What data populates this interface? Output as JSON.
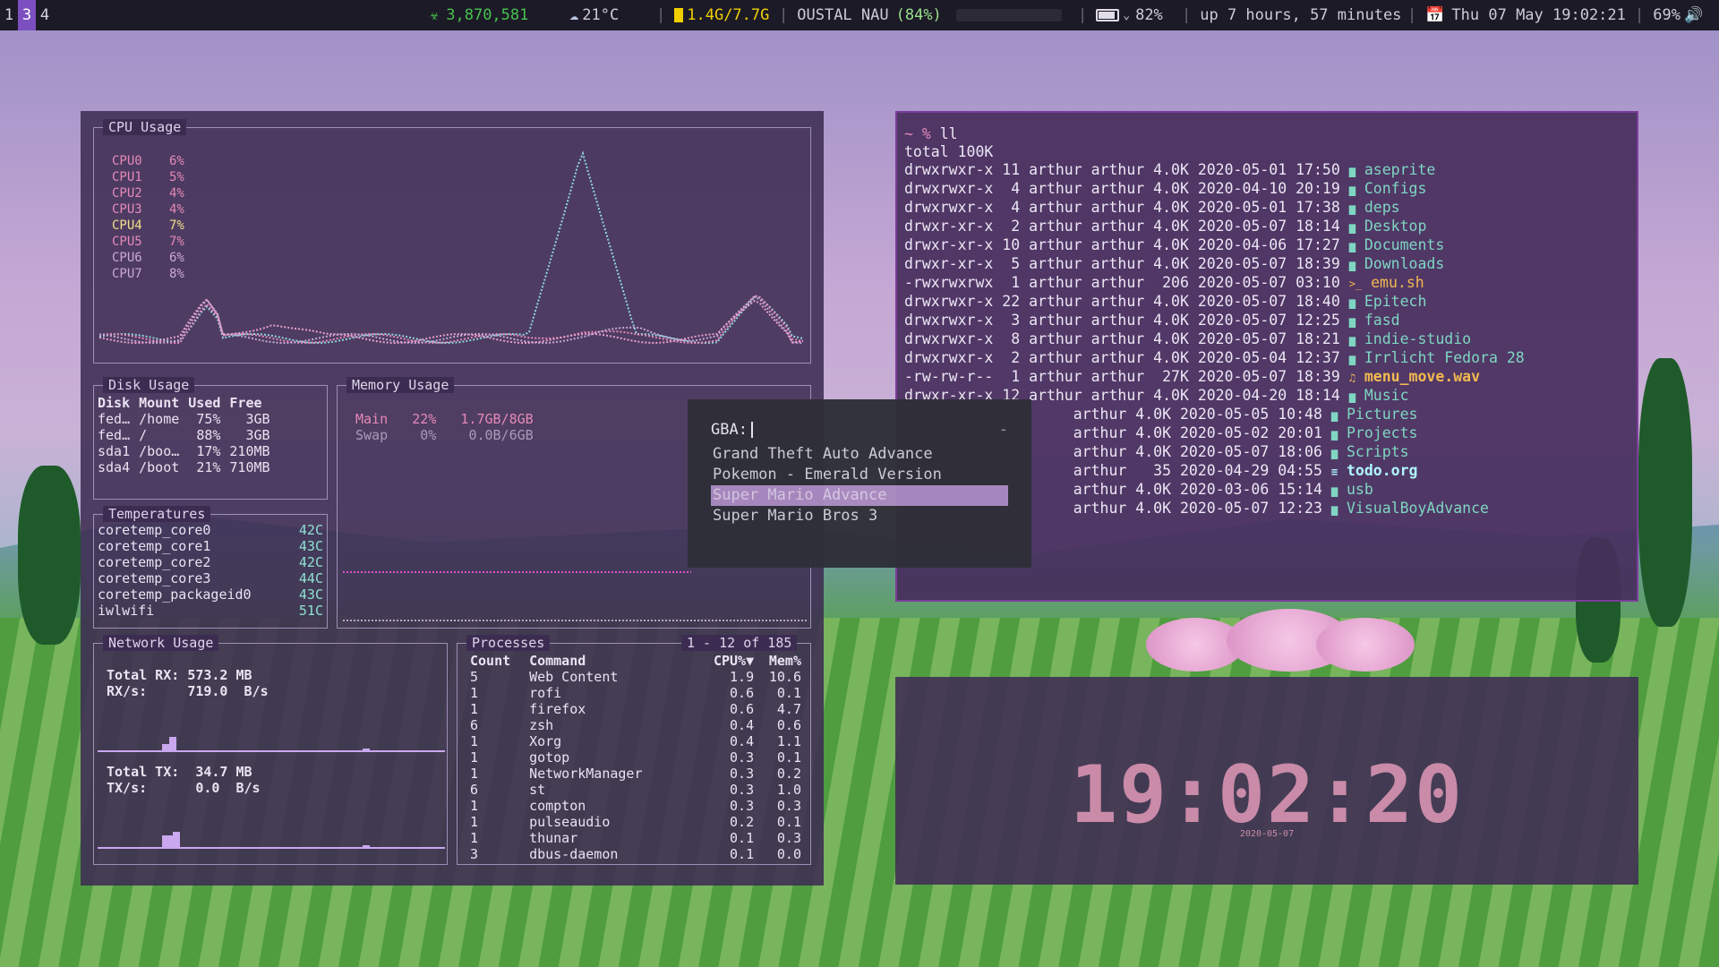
{
  "topbar": {
    "workspaces": [
      {
        "label": "1",
        "active": false
      },
      {
        "label": "3",
        "active": true
      },
      {
        "label": "4",
        "active": false
      }
    ],
    "counter": "3,870,581",
    "weather": "21°C",
    "memory": "1.4G/7.7G",
    "network_name": "OUSTAL NAU",
    "network_strength": "(84%)",
    "battery": "82%",
    "uptime": "up 7 hours, 57 minutes",
    "datetime": "Thu 07 May 19:02:21",
    "volume": "69%",
    "colors": {
      "counter": "#46c24e",
      "memory": "#f0d000",
      "network_strength": "#9ae08c"
    }
  },
  "system_monitor": {
    "cpu": {
      "title": "CPU Usage",
      "cores": [
        {
          "name": "CPU0",
          "value": "6%"
        },
        {
          "name": "CPU1",
          "value": "5%"
        },
        {
          "name": "CPU2",
          "value": "4%"
        },
        {
          "name": "CPU3",
          "value": "4%"
        },
        {
          "name": "CPU4",
          "value": "7%"
        },
        {
          "name": "CPU5",
          "value": "7%"
        },
        {
          "name": "CPU6",
          "value": "6%"
        },
        {
          "name": "CPU7",
          "value": "8%"
        }
      ]
    },
    "disk": {
      "title": "Disk Usage",
      "headers": [
        "Disk",
        "Mount",
        "Used",
        "Free"
      ],
      "rows": [
        [
          "fed…",
          "/home",
          "75%",
          "3GB"
        ],
        [
          "fed…",
          "/",
          "88%",
          "3GB"
        ],
        [
          "sda1",
          "/boo…",
          "17%",
          "210MB"
        ],
        [
          "sda4",
          "/boot",
          "21%",
          "710MB"
        ]
      ]
    },
    "memory": {
      "title": "Memory Usage",
      "main": {
        "label": "Main",
        "pct": "22%",
        "value": "1.7GB/8GB"
      },
      "swap": {
        "label": "Swap",
        "pct": "0%",
        "value": "0.0B/6GB"
      }
    },
    "temps": {
      "title": "Temperatures",
      "rows": [
        [
          "coretemp_core0",
          "42C"
        ],
        [
          "coretemp_core1",
          "43C"
        ],
        [
          "coretemp_core2",
          "42C"
        ],
        [
          "coretemp_core3",
          "44C"
        ],
        [
          "coretemp_packageid0",
          "43C"
        ],
        [
          "iwlwifi",
          "51C"
        ]
      ]
    },
    "network": {
      "title": "Network Usage",
      "rx_total_label": "Total RX:",
      "rx_total": "573.2 MB",
      "rx_rate_label": "RX/s:",
      "rx_rate": "719.0  B/s",
      "tx_total_label": "Total TX:",
      "tx_total": "34.7 MB",
      "tx_rate_label": "TX/s:",
      "tx_rate": "0.0  B/s"
    },
    "processes": {
      "title": "Processes",
      "range": "1 - 12 of 185",
      "headers": [
        "Count",
        "Command",
        "CPU%▼",
        "Mem%"
      ],
      "rows": [
        [
          "5",
          "Web Content",
          "1.9",
          "10.6"
        ],
        [
          "1",
          "rofi",
          "0.6",
          "0.1"
        ],
        [
          "1",
          "firefox",
          "0.6",
          "4.7"
        ],
        [
          "6",
          "zsh",
          "0.4",
          "0.6"
        ],
        [
          "1",
          "Xorg",
          "0.4",
          "1.1"
        ],
        [
          "1",
          "gotop",
          "0.3",
          "0.1"
        ],
        [
          "1",
          "NetworkManager",
          "0.3",
          "0.2"
        ],
        [
          "6",
          "st",
          "0.3",
          "1.0"
        ],
        [
          "1",
          "compton",
          "0.3",
          "0.3"
        ],
        [
          "1",
          "pulseaudio",
          "0.2",
          "0.1"
        ],
        [
          "1",
          "thunar",
          "0.1",
          "0.3"
        ],
        [
          "3",
          "dbus-daemon",
          "0.1",
          "0.0"
        ]
      ]
    }
  },
  "terminal": {
    "prompt": "~ %",
    "command": "ll",
    "total": "total 100K",
    "entries": [
      {
        "perms": "drwxrwxr-x 11 arthur arthur 4.0K 2020-05-01 17:50",
        "name": "aseprite",
        "kind": "dir"
      },
      {
        "perms": "drwxrwxr-x  4 arthur arthur 4.0K 2020-04-10 20:19",
        "name": "Configs",
        "kind": "dir"
      },
      {
        "perms": "drwxrwxr-x  4 arthur arthur 4.0K 2020-05-01 17:38",
        "name": "deps",
        "kind": "dir"
      },
      {
        "perms": "drwxr-xr-x  2 arthur arthur 4.0K 2020-05-07 18:14",
        "name": "Desktop",
        "kind": "dir"
      },
      {
        "perms": "drwxr-xr-x 10 arthur arthur 4.0K 2020-04-06 17:27",
        "name": "Documents",
        "kind": "dir"
      },
      {
        "perms": "drwxr-xr-x  5 arthur arthur 4.0K 2020-05-07 18:39",
        "name": "Downloads",
        "kind": "dir"
      },
      {
        "perms": "-rwxrwxrwx  1 arthur arthur  206 2020-05-07 03:10",
        "name": "emu.sh",
        "kind": "exe"
      },
      {
        "perms": "drwxrwxr-x 22 arthur arthur 4.0K 2020-05-07 18:40",
        "name": "Epitech",
        "kind": "dir"
      },
      {
        "perms": "drwxrwxr-x  3 arthur arthur 4.0K 2020-05-07 12:25",
        "name": "fasd",
        "kind": "dir"
      },
      {
        "perms": "drwxrwxr-x  8 arthur arthur 4.0K 2020-05-07 18:21",
        "name": "indie-studio",
        "kind": "dir"
      },
      {
        "perms": "drwxrwxr-x  2 arthur arthur 4.0K 2020-05-04 12:37",
        "name": "Irrlicht Fedora 28",
        "kind": "dir"
      },
      {
        "perms": "-rw-rw-r--  1 arthur arthur  27K 2020-05-07 18:39",
        "name": "menu_move.wav",
        "kind": "audio"
      },
      {
        "perms": "drwxr-xr-x 12 arthur arthur 4.0K 2020-04-20 18:14",
        "name": "Music",
        "kind": "dir"
      },
      {
        "perms": "                   arthur 4.0K 2020-05-05 10:48",
        "name": "Pictures",
        "kind": "dir"
      },
      {
        "perms": "                   arthur 4.0K 2020-05-02 20:01",
        "name": "Projects",
        "kind": "dir"
      },
      {
        "perms": "                   arthur 4.0K 2020-05-07 18:06",
        "name": "Scripts",
        "kind": "dir"
      },
      {
        "perms": "                   arthur   35 2020-04-29 04:55",
        "name": "todo.org",
        "kind": "org"
      },
      {
        "perms": "                   arthur 4.0K 2020-03-06 15:14",
        "name": "usb",
        "kind": "dir"
      },
      {
        "perms": "                   arthur 4.0K 2020-05-07 12:23",
        "name": "VisualBoyAdvance",
        "kind": "dir"
      }
    ]
  },
  "rofi": {
    "prompt": "GBA:",
    "indicator": "-",
    "items": [
      "Grand Theft Auto Advance",
      "Pokemon - Emerald Version",
      "Super Mario Advance",
      "Super Mario Bros 3"
    ],
    "selected_index": 2
  },
  "clock": {
    "time": "19:02:20",
    "date": "2020-05-07"
  }
}
